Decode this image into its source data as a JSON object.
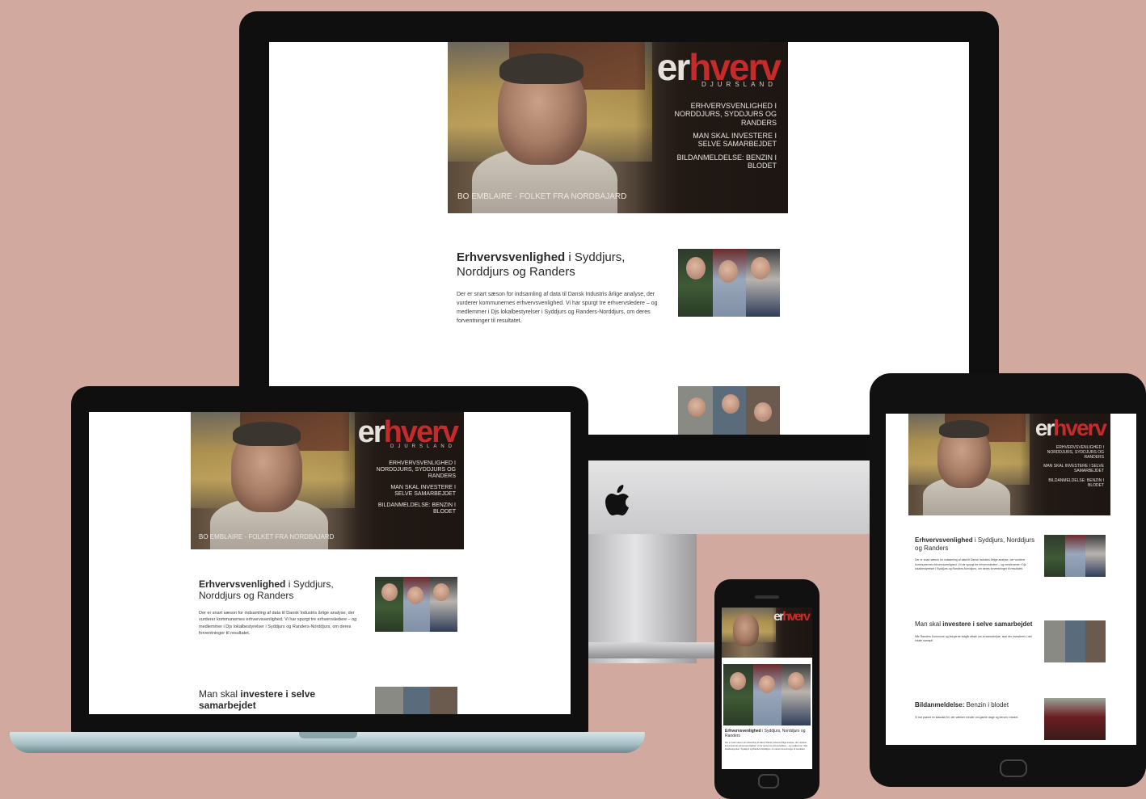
{
  "brand": {
    "logo_er": "er",
    "logo_hverv": "hverv",
    "logo_sub": "DJURSLAND"
  },
  "hero": {
    "side_block1": "ERHVERVSVENLIGHED I NORDDJURS, SYDDJURS OG RANDERS",
    "side_block2": "MAN SKAL INVESTERE I SELVE SAMARBEJDET",
    "side_block3": "BILDANMELDELSE: BENZIN I BLODET",
    "caption": "BO EMBLAIRE - FOLKET FRA NORDBAJARD"
  },
  "articles": [
    {
      "title_bold": "Erhvervsvenlighed",
      "title_rest": " i Syddjurs, Norddjurs og Randers",
      "body": "Der er snart sæson for indsamling af data til Dansk Industris årlige analyse, der vurderer kommunernes erhvervsvenlighed. Vi har spurgt tre erhvervsledere – og medlemmer i Djs lokalbestyrelser i Syddjurs og Randers-Norddjurs, om deres forventninger til resultatet."
    },
    {
      "title_rest": "Man skal ",
      "title_bold": "investere i selve samarbejdet",
      "body": "Når Randers Kommune og borgerne indgår aftale om at samarbejde, skal der investeres i det lokale samspil."
    },
    {
      "title_bold": "Bildanmeldelse:",
      "title_rest": " Benzin i blodet",
      "body": "Vi har prøvet en klassisk bil, der vækker minder om gamle dage og benzin i blodet."
    }
  ]
}
